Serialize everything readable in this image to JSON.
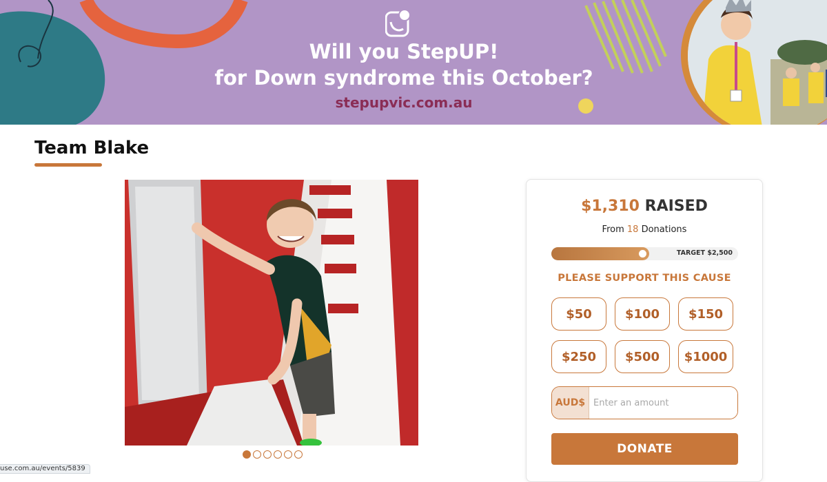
{
  "banner": {
    "headline_line1": "Will you StepUP!",
    "headline_line2": "for Down syndrome this October?",
    "url": "stepupvic.com.au"
  },
  "page": {
    "title": "Team Blake"
  },
  "gallery": {
    "slide_count": 6,
    "active_index": 0
  },
  "status_bar": {
    "url": "use.com.au/events/5839"
  },
  "donation": {
    "raised_amount": "$1,310",
    "raised_label": "RAISED",
    "from_prefix": "From",
    "donation_count": "18",
    "from_suffix": "Donations",
    "target_label": "TARGET $2,500",
    "progress_fraction": 0.524,
    "support_heading": "PLEASE SUPPORT THIS CAUSE",
    "amounts": [
      "$50",
      "$100",
      "$150",
      "$250",
      "$500",
      "$1000"
    ],
    "currency_label": "AUD$",
    "amount_placeholder": "Enter an amount",
    "donate_label": "DONATE"
  },
  "colors": {
    "accent": "#c8773a",
    "banner_bg": "#b195c6",
    "banner_url": "#8a2d55"
  }
}
